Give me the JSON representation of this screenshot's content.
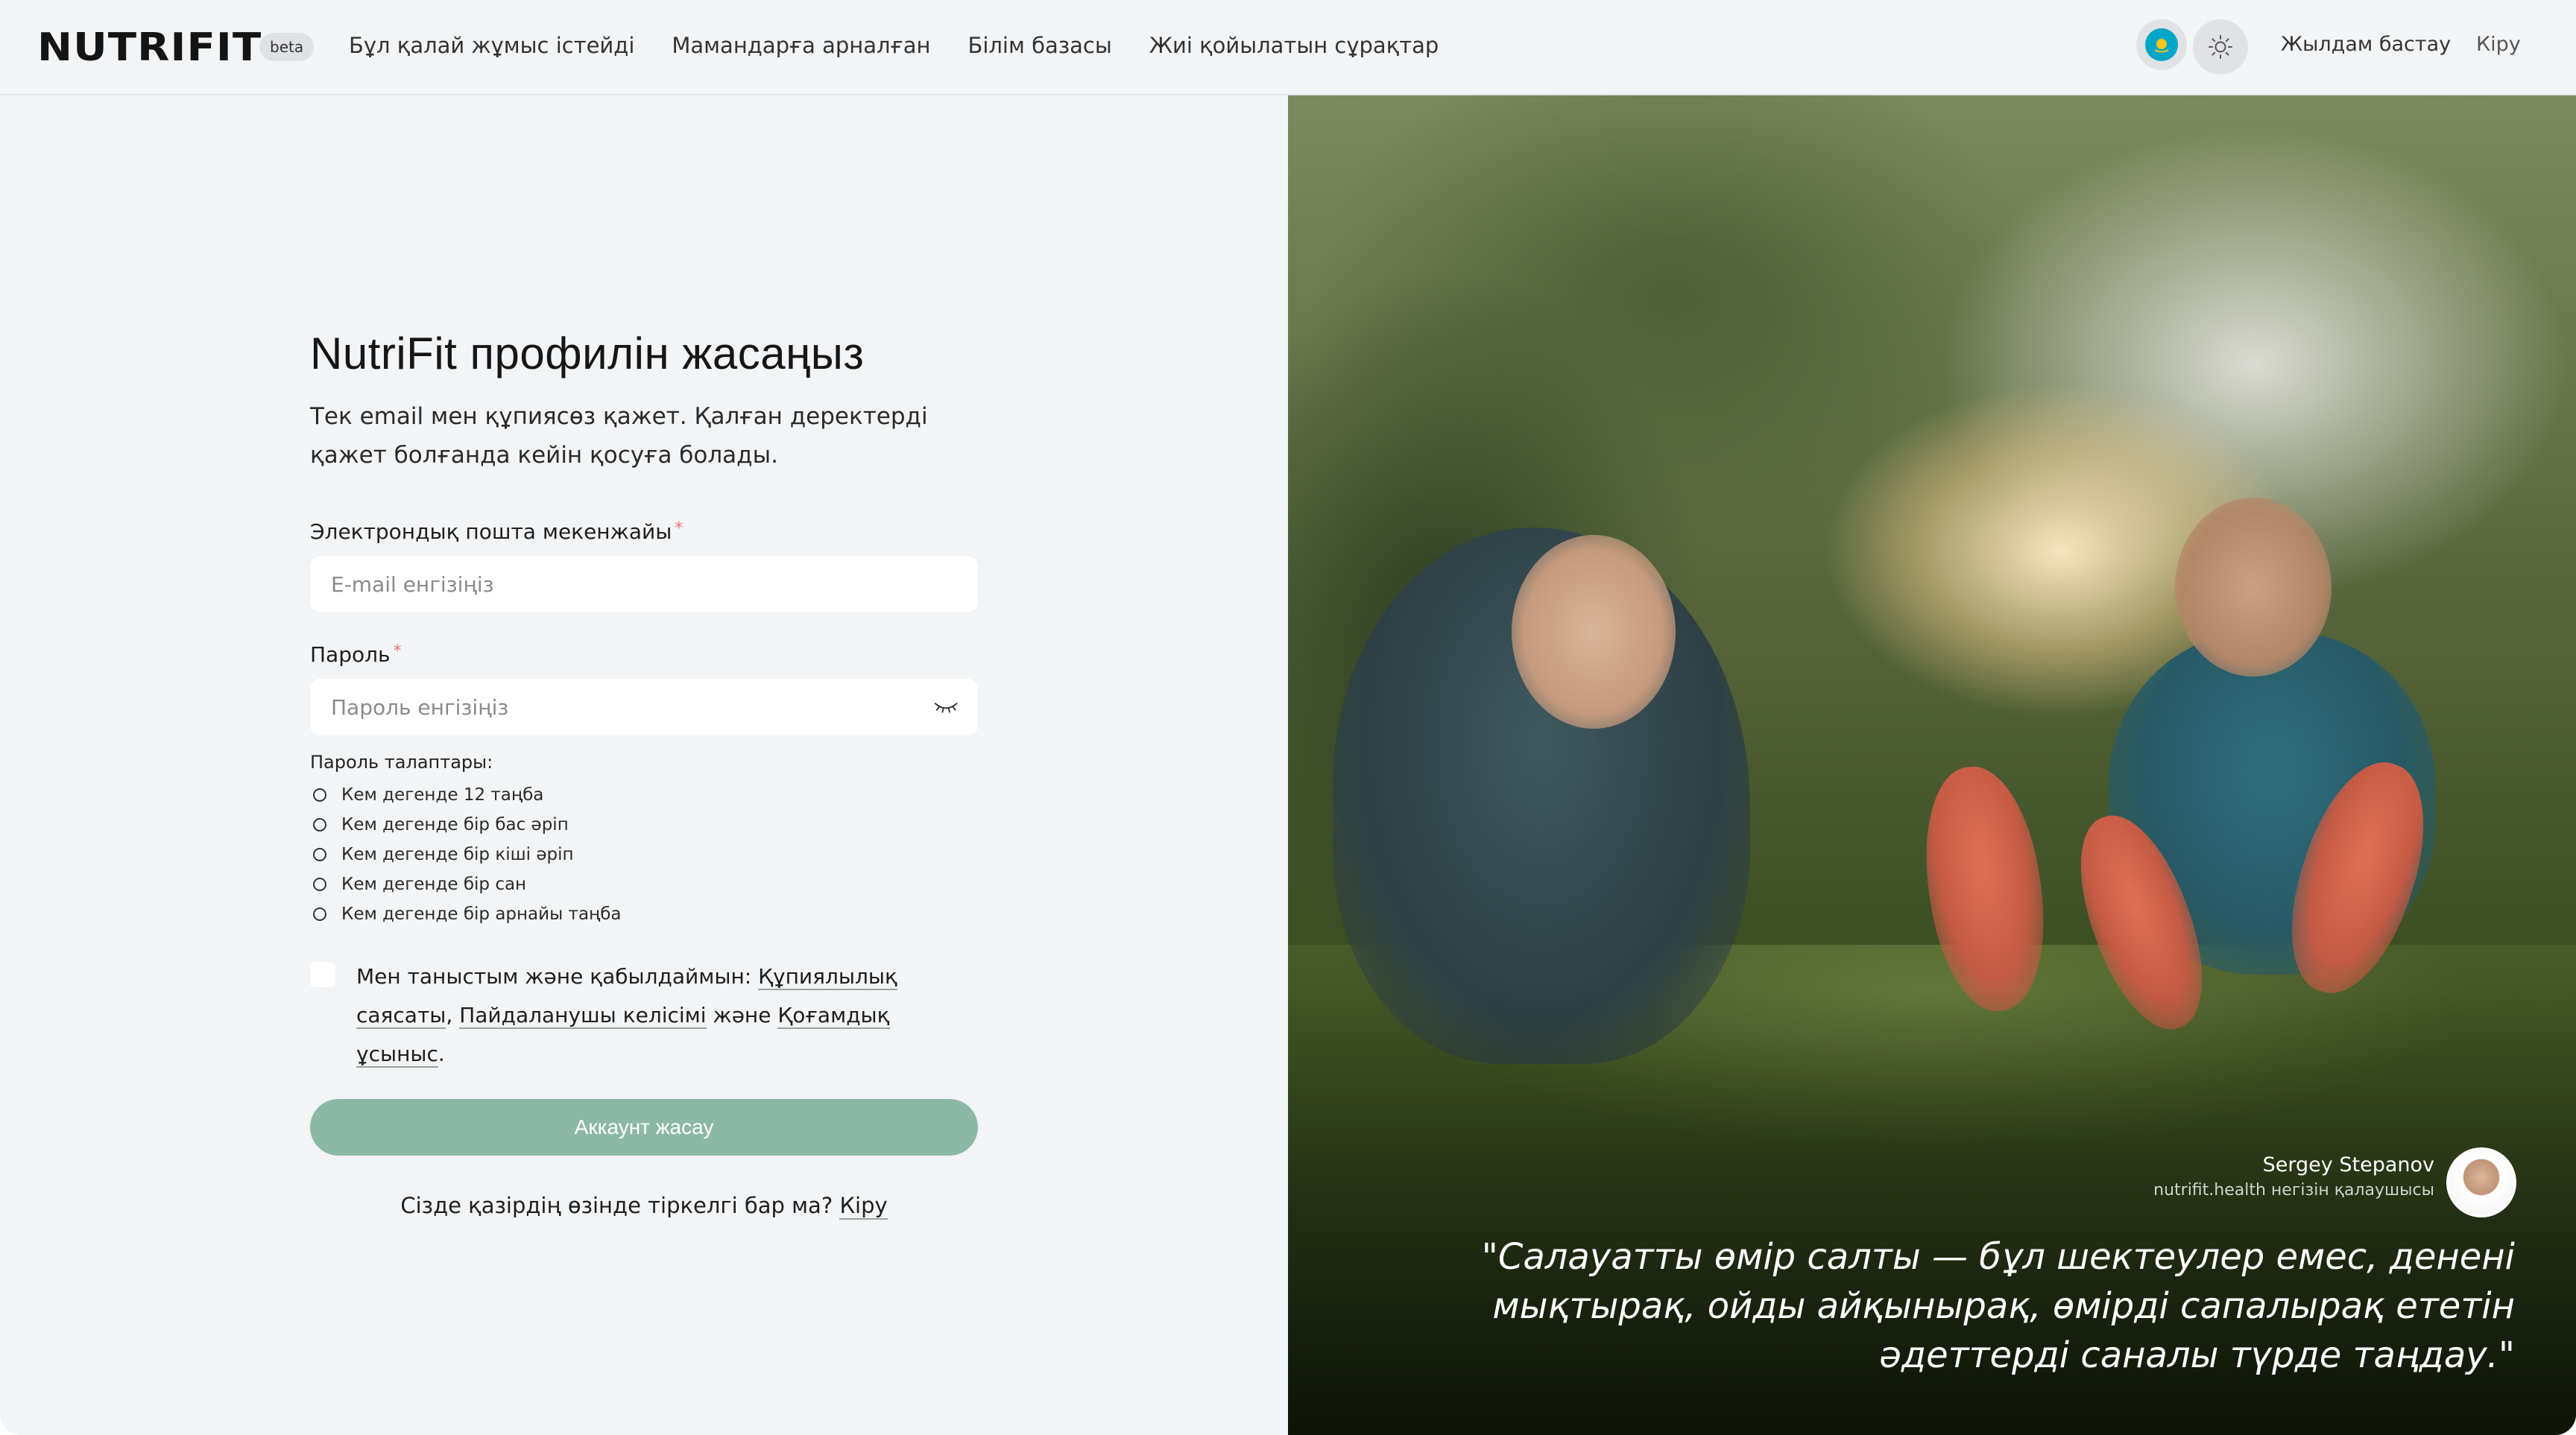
{
  "header": {
    "logo": "NUTRIFIT",
    "badge": "beta",
    "nav": [
      "Бұл қалай жұмыс істейді",
      "Мамандарға арналған",
      "Білім базасы",
      "Жиі қойылатын сұрақтар"
    ],
    "quick_start": "Жылдам бастау",
    "login": "Кіру"
  },
  "form": {
    "title": "NutriFit профилін жасаңыз",
    "subtitle": "Тек email мен құпиясөз қажет. Қалған деректерді қажет болғанда кейін қосуға болады.",
    "email_label": "Электрондық пошта мекенжайы",
    "email_placeholder": "E-mail енгізіңіз",
    "password_label": "Пароль",
    "password_placeholder": "Пароль енгізіңіз",
    "required_mark": "*",
    "requirements_title": "Пароль талаптары:",
    "requirements": [
      "Кем дегенде 12 таңба",
      "Кем дегенде бір бас әріп",
      "Кем дегенде бір кіші әріп",
      "Кем дегенде бір сан",
      "Кем дегенде бір арнайы таңба"
    ],
    "consent_prefix": "Мен таныстым және қабылдаймын:",
    "consent_privacy": "Құпиялылық саясаты",
    "consent_comma": ",",
    "consent_terms": "Пайдаланушы келісімі",
    "consent_and": "және",
    "consent_offer": "Қоғамдық ұсыныс",
    "consent_end": ".",
    "submit": "Аккаунт жасау",
    "have_account": "Сізде қазірдің өзінде тіркелгі бар ма?",
    "signin_link": "Кіру"
  },
  "testimonial": {
    "name": "Sergey Stepanov",
    "role": "nutrifit.health негізін қалаушысы",
    "quote": "\"Салауатты өмір салты — бұл шектеулер емес, денені мықтырақ, ойды айқынырақ, өмірді сапалырақ ететін әдеттерді саналы түрде таңдау.\""
  },
  "colors": {
    "accent_button": "#8cb9a5",
    "background": "#f3f4f6"
  },
  "icons": {
    "language": "kazakhstan-flag-icon",
    "theme": "sun-icon",
    "password_toggle": "eye-closed-icon"
  }
}
